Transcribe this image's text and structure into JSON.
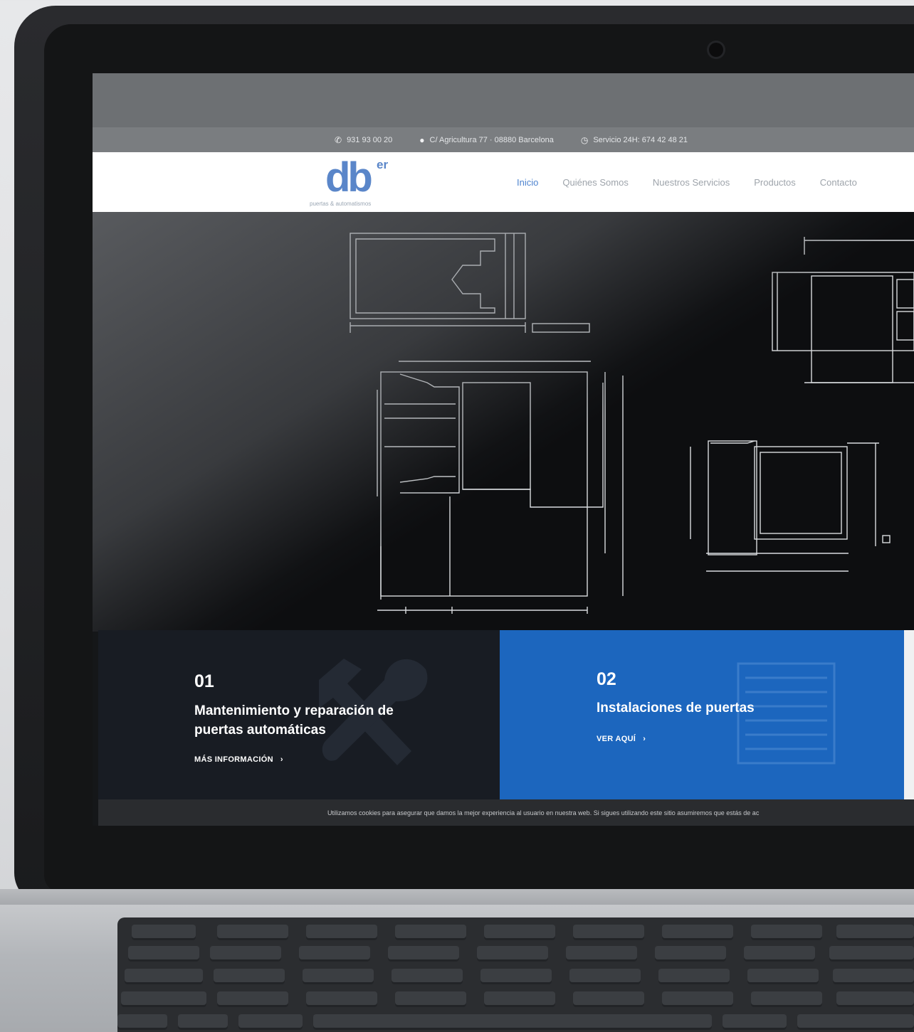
{
  "contact_bar": {
    "phone": "931 93 00 20",
    "address": "C/ Agricultura 77 · 08880 Barcelona",
    "service": "Servicio 24H: 674 42 48 21",
    "icons": [
      "phone-icon",
      "map-pin-icon",
      "clock-icon"
    ]
  },
  "header": {
    "logo_text": "db",
    "logo_superscript": "er",
    "logo_tagline": "puertas & automatismos",
    "nav": [
      {
        "label": "Inicio",
        "active": true
      },
      {
        "label": "Quiénes Somos",
        "active": false
      },
      {
        "label": "Nuestros Servicios",
        "active": false
      },
      {
        "label": "Productos",
        "active": false
      },
      {
        "label": "Contacto",
        "active": false
      }
    ]
  },
  "cards": [
    {
      "number": "01",
      "title": "Mantenimiento y reparación de puertas automáticas",
      "link": "MÁS INFORMACIÓN",
      "icon": "tools-icon",
      "color": "#181c23"
    },
    {
      "number": "02",
      "title": "Instalaciones de puertas",
      "link": "VER AQUÍ",
      "icon": "door-icon",
      "color": "#1c66be"
    }
  ],
  "cookie_notice": "Utilizamos cookies para asegurar que damos la mejor experiencia al usuario en nuestra web. Si sigues utilizando este sitio asumiremos que estás de ac",
  "colors": {
    "accent": "#4e84cf",
    "logo": "#5a86c9",
    "card_blue": "#1c66be",
    "card_dark": "#181c23"
  }
}
